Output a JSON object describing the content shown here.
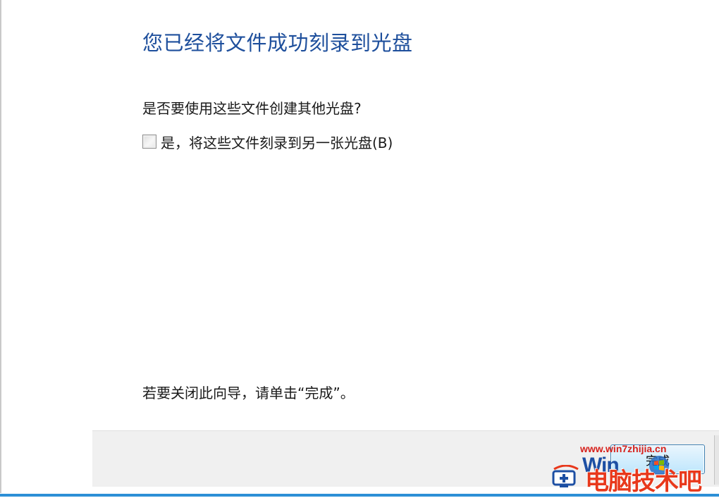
{
  "wizard": {
    "title": "您已经将文件成功刻录到光盘",
    "question": "是否要使用这些文件创建其他光盘?",
    "checkbox": {
      "label": "是，将这些文件刻录到另一张光盘(B)",
      "checked": false
    },
    "close_hint": "若要关闭此向导，请单击“完成”。",
    "finish_button_label": "完成"
  },
  "watermark": {
    "url": "www.win7zhijia.cn",
    "brand_prefix": "Win",
    "brand_cn": "电脑技术吧",
    "icons": [
      "computer-icon",
      "windows-logo-icon"
    ]
  },
  "colors": {
    "title": "#1e4f9c",
    "accent_line": "#2d8fd6",
    "footer_bg": "#f0f0f0",
    "watermark_red": "#e8381b",
    "watermark_blue": "#1d4fa3"
  }
}
